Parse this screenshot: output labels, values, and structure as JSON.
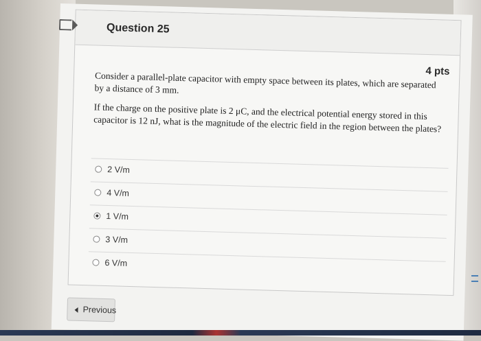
{
  "question": {
    "title": "Question 25",
    "points": "4 pts",
    "paragraphs": [
      "Consider a parallel-plate capacitor with empty space between its plates, which are separated by a distance of 3 mm.",
      "If the charge on the positive plate is 2 μC, and the electrical potential energy stored in this capacitor is 12 nJ, what is the magnitude of the electric field in the region between the plates?"
    ],
    "answers": [
      {
        "label": "2 V/m",
        "selected": false
      },
      {
        "label": "4 V/m",
        "selected": false
      },
      {
        "label": "1 V/m",
        "selected": true
      },
      {
        "label": "3 V/m",
        "selected": false
      },
      {
        "label": "6 V/m",
        "selected": false
      }
    ]
  },
  "nav": {
    "previous_label": "Previous"
  },
  "icons": {
    "flag": "flag-icon",
    "previous": "chevron-left-icon"
  }
}
